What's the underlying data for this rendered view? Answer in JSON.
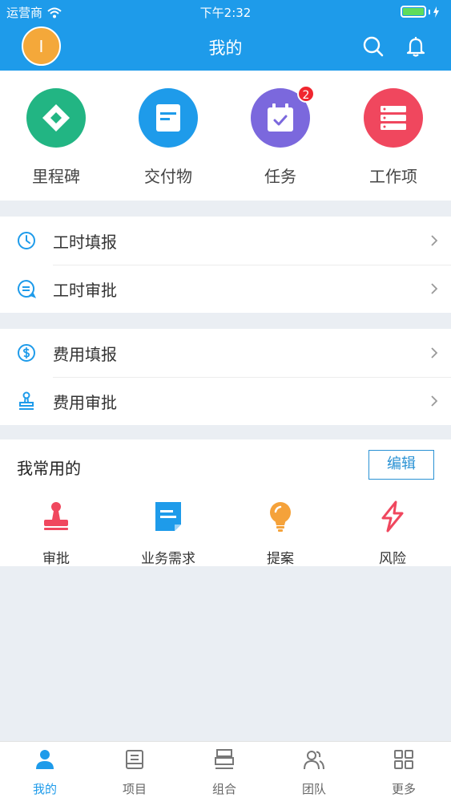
{
  "status": {
    "carrier": "运营商",
    "time": "下午2:32"
  },
  "header": {
    "avatar_letter": "I",
    "title": "我的"
  },
  "quick": [
    {
      "label": "里程碑",
      "color": "#22b583",
      "icon": "milestone-icon"
    },
    {
      "label": "交付物",
      "color": "#1e9bea",
      "icon": "document-icon"
    },
    {
      "label": "任务",
      "color": "#7b68dd",
      "icon": "task-calendar-icon",
      "badge": "2"
    },
    {
      "label": "工作项",
      "color": "#f0475e",
      "icon": "server-list-icon"
    }
  ],
  "group1": {
    "rows": [
      {
        "label": "工时填报",
        "icon": "clock-icon"
      },
      {
        "label": "工时审批",
        "icon": "chat-approve-icon"
      }
    ]
  },
  "group2": {
    "rows": [
      {
        "label": "费用填报",
        "icon": "dollar-icon"
      },
      {
        "label": "费用审批",
        "icon": "stamp-icon"
      }
    ]
  },
  "favorites": {
    "title": "我常用的",
    "edit_label": "编辑",
    "items": [
      {
        "label": "审批",
        "icon": "stamp-icon",
        "color": "#f0475e"
      },
      {
        "label": "业务需求",
        "icon": "document-icon",
        "color": "#1e9bea"
      },
      {
        "label": "提案",
        "icon": "lightbulb-icon",
        "color": "#f5a23a"
      },
      {
        "label": "风险",
        "icon": "lightning-icon",
        "color": "#f0475e"
      }
    ]
  },
  "tabs": [
    {
      "label": "我的",
      "icon": "person-icon",
      "active": true
    },
    {
      "label": "项目",
      "icon": "project-icon"
    },
    {
      "label": "组合",
      "icon": "portfolio-icon"
    },
    {
      "label": "团队",
      "icon": "team-icon"
    },
    {
      "label": "更多",
      "icon": "grid-icon"
    }
  ],
  "colors": {
    "primary": "#1e9bea",
    "badge": "#f0262f",
    "avatar": "#f4a83a"
  }
}
